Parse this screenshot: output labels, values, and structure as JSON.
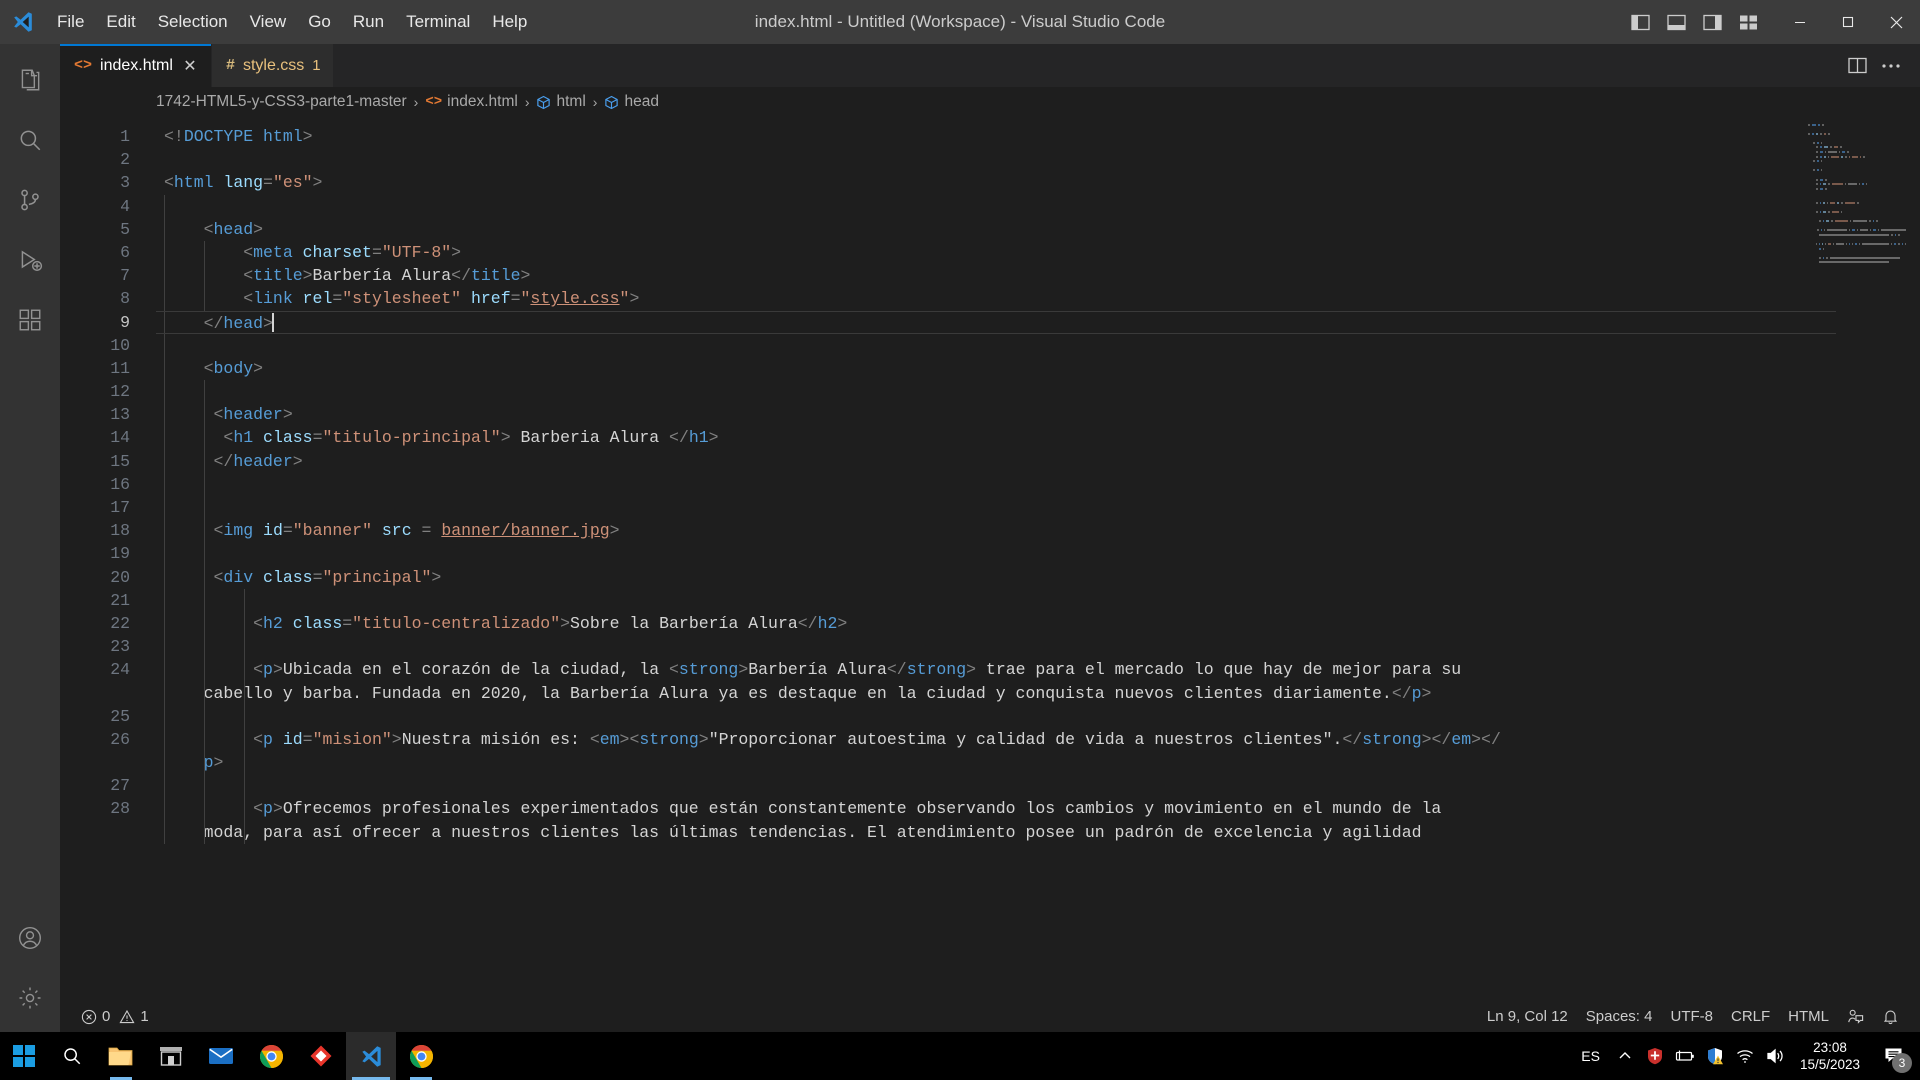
{
  "window": {
    "title": "index.html - Untitled (Workspace) - Visual Studio Code",
    "menu": [
      "File",
      "Edit",
      "Selection",
      "View",
      "Go",
      "Run",
      "Terminal",
      "Help"
    ],
    "controls": {
      "minimize": "−",
      "maximize": "☐",
      "close": "✕"
    },
    "layout_icons": [
      "panel-left-icon",
      "panel-bottom-icon",
      "panel-right-icon",
      "customize-layout-icon"
    ]
  },
  "activitybar": {
    "items": [
      {
        "name": "explorer",
        "icon": "files-icon"
      },
      {
        "name": "search",
        "icon": "search-icon"
      },
      {
        "name": "source-control",
        "icon": "source-control-icon"
      },
      {
        "name": "run-and-debug",
        "icon": "debug-icon"
      },
      {
        "name": "extensions",
        "icon": "extensions-icon"
      }
    ],
    "bottom": [
      {
        "name": "accounts",
        "icon": "account-icon"
      },
      {
        "name": "settings",
        "icon": "gear-icon"
      }
    ]
  },
  "tabs": [
    {
      "label": "index.html",
      "icon": "html5-icon",
      "active": true,
      "close": "✕",
      "badge": ""
    },
    {
      "label": "style.css",
      "icon": "css-icon",
      "active": false,
      "close": "",
      "badge": "1"
    }
  ],
  "tabs_actions": [
    "split-editor-icon",
    "more-actions-icon"
  ],
  "breadcrumb": [
    {
      "label": "1742-HTML5-y-CSS3-parte1-master",
      "icon": ""
    },
    {
      "label": "index.html",
      "icon": "html5-icon"
    },
    {
      "label": "html",
      "icon": "symbol-field-icon"
    },
    {
      "label": "head",
      "icon": "symbol-field-icon"
    }
  ],
  "breadcrumb_separator": "›",
  "editor": {
    "first_line": 1,
    "active_line": 9,
    "cursor_line_index": 8,
    "lines": [
      {
        "n": 1,
        "indent": 0,
        "tokens": [
          {
            "c": "punct",
            "t": "<!"
          },
          {
            "c": "doctype",
            "t": "DOCTYPE"
          },
          {
            "c": "txt",
            "t": " "
          },
          {
            "c": "tag",
            "t": "html"
          },
          {
            "c": "punct",
            "t": ">"
          }
        ]
      },
      {
        "n": 2,
        "indent": 0,
        "tokens": []
      },
      {
        "n": 3,
        "indent": 0,
        "tokens": [
          {
            "c": "punct",
            "t": "<"
          },
          {
            "c": "tag",
            "t": "html"
          },
          {
            "c": "txt",
            "t": " "
          },
          {
            "c": "attr",
            "t": "lang"
          },
          {
            "c": "punct",
            "t": "="
          },
          {
            "c": "str",
            "t": "\"es\""
          },
          {
            "c": "punct",
            "t": ">"
          }
        ]
      },
      {
        "n": 4,
        "indent": 1,
        "tokens": []
      },
      {
        "n": 5,
        "indent": 1,
        "tokens": [
          {
            "c": "txt",
            "t": "    "
          },
          {
            "c": "punct",
            "t": "<"
          },
          {
            "c": "tag",
            "t": "head"
          },
          {
            "c": "punct",
            "t": ">"
          }
        ]
      },
      {
        "n": 6,
        "indent": 2,
        "tokens": [
          {
            "c": "txt",
            "t": "        "
          },
          {
            "c": "punct",
            "t": "<"
          },
          {
            "c": "tag",
            "t": "meta"
          },
          {
            "c": "txt",
            "t": " "
          },
          {
            "c": "attr",
            "t": "charset"
          },
          {
            "c": "punct",
            "t": "="
          },
          {
            "c": "str",
            "t": "\"UTF-8\""
          },
          {
            "c": "punct",
            "t": ">"
          }
        ]
      },
      {
        "n": 7,
        "indent": 2,
        "tokens": [
          {
            "c": "txt",
            "t": "        "
          },
          {
            "c": "punct",
            "t": "<"
          },
          {
            "c": "tag",
            "t": "title"
          },
          {
            "c": "punct",
            "t": ">"
          },
          {
            "c": "txt",
            "t": "Barbería Alura"
          },
          {
            "c": "punct",
            "t": "</"
          },
          {
            "c": "tag",
            "t": "title"
          },
          {
            "c": "punct",
            "t": ">"
          }
        ]
      },
      {
        "n": 8,
        "indent": 2,
        "tokens": [
          {
            "c": "txt",
            "t": "        "
          },
          {
            "c": "punct",
            "t": "<"
          },
          {
            "c": "tag",
            "t": "link"
          },
          {
            "c": "txt",
            "t": " "
          },
          {
            "c": "attr",
            "t": "rel"
          },
          {
            "c": "punct",
            "t": "="
          },
          {
            "c": "str",
            "t": "\"stylesheet\""
          },
          {
            "c": "txt",
            "t": " "
          },
          {
            "c": "attr",
            "t": "href"
          },
          {
            "c": "punct",
            "t": "="
          },
          {
            "c": "str",
            "t": "\""
          },
          {
            "c": "link",
            "t": "style.css"
          },
          {
            "c": "str",
            "t": "\""
          },
          {
            "c": "punct",
            "t": ">"
          }
        ]
      },
      {
        "n": 9,
        "indent": 1,
        "active": true,
        "cursor": true,
        "tokens": [
          {
            "c": "txt",
            "t": "    "
          },
          {
            "c": "punct",
            "t": "</"
          },
          {
            "c": "tag",
            "t": "head"
          },
          {
            "c": "punct",
            "t": ">"
          }
        ]
      },
      {
        "n": 10,
        "indent": 1,
        "tokens": []
      },
      {
        "n": 11,
        "indent": 1,
        "tokens": [
          {
            "c": "txt",
            "t": "    "
          },
          {
            "c": "punct",
            "t": "<"
          },
          {
            "c": "tag",
            "t": "body"
          },
          {
            "c": "punct",
            "t": ">"
          }
        ]
      },
      {
        "n": 12,
        "indent": 2,
        "tokens": []
      },
      {
        "n": 13,
        "indent": 2,
        "tokens": [
          {
            "c": "txt",
            "t": "     "
          },
          {
            "c": "punct",
            "t": "<"
          },
          {
            "c": "tag",
            "t": "header"
          },
          {
            "c": "punct",
            "t": ">"
          }
        ]
      },
      {
        "n": 14,
        "indent": 2,
        "tokens": [
          {
            "c": "txt",
            "t": "      "
          },
          {
            "c": "punct",
            "t": "<"
          },
          {
            "c": "tag",
            "t": "h1"
          },
          {
            "c": "txt",
            "t": " "
          },
          {
            "c": "attr",
            "t": "class"
          },
          {
            "c": "punct",
            "t": "="
          },
          {
            "c": "str",
            "t": "\"titulo-principal\""
          },
          {
            "c": "punct",
            "t": ">"
          },
          {
            "c": "txt",
            "t": " Barberia Alura "
          },
          {
            "c": "punct",
            "t": "</"
          },
          {
            "c": "tag",
            "t": "h1"
          },
          {
            "c": "punct",
            "t": ">"
          }
        ]
      },
      {
        "n": 15,
        "indent": 2,
        "tokens": [
          {
            "c": "txt",
            "t": "     "
          },
          {
            "c": "punct",
            "t": "</"
          },
          {
            "c": "tag",
            "t": "header"
          },
          {
            "c": "punct",
            "t": ">"
          }
        ]
      },
      {
        "n": 16,
        "indent": 2,
        "tokens": []
      },
      {
        "n": 17,
        "indent": 2,
        "tokens": []
      },
      {
        "n": 18,
        "indent": 2,
        "tokens": [
          {
            "c": "txt",
            "t": "     "
          },
          {
            "c": "punct",
            "t": "<"
          },
          {
            "c": "tag",
            "t": "img"
          },
          {
            "c": "txt",
            "t": " "
          },
          {
            "c": "attr",
            "t": "id"
          },
          {
            "c": "punct",
            "t": "="
          },
          {
            "c": "str",
            "t": "\"banner\""
          },
          {
            "c": "txt",
            "t": " "
          },
          {
            "c": "attr",
            "t": "src"
          },
          {
            "c": "txt",
            "t": " "
          },
          {
            "c": "punct",
            "t": "= "
          },
          {
            "c": "link",
            "t": "banner/banner.jpg"
          },
          {
            "c": "punct",
            "t": ">"
          }
        ]
      },
      {
        "n": 19,
        "indent": 2,
        "tokens": []
      },
      {
        "n": 20,
        "indent": 2,
        "tokens": [
          {
            "c": "txt",
            "t": "     "
          },
          {
            "c": "punct",
            "t": "<"
          },
          {
            "c": "tag",
            "t": "div"
          },
          {
            "c": "txt",
            "t": " "
          },
          {
            "c": "attr",
            "t": "class"
          },
          {
            "c": "punct",
            "t": "="
          },
          {
            "c": "str",
            "t": "\"principal\""
          },
          {
            "c": "punct",
            "t": ">"
          }
        ]
      },
      {
        "n": 21,
        "indent": 3,
        "tokens": []
      },
      {
        "n": 22,
        "indent": 3,
        "tokens": [
          {
            "c": "txt",
            "t": "         "
          },
          {
            "c": "punct",
            "t": "<"
          },
          {
            "c": "tag",
            "t": "h2"
          },
          {
            "c": "txt",
            "t": " "
          },
          {
            "c": "attr",
            "t": "class"
          },
          {
            "c": "punct",
            "t": "="
          },
          {
            "c": "str",
            "t": "\"titulo-centralizado\""
          },
          {
            "c": "punct",
            "t": ">"
          },
          {
            "c": "txt",
            "t": "Sobre la Barbería Alura"
          },
          {
            "c": "punct",
            "t": "</"
          },
          {
            "c": "tag",
            "t": "h2"
          },
          {
            "c": "punct",
            "t": ">"
          }
        ]
      },
      {
        "n": 23,
        "indent": 3,
        "tokens": []
      },
      {
        "n": 24,
        "indent": 3,
        "tokens": [
          {
            "c": "txt",
            "t": "         "
          },
          {
            "c": "punct",
            "t": "<"
          },
          {
            "c": "tag",
            "t": "p"
          },
          {
            "c": "punct",
            "t": ">"
          },
          {
            "c": "txt",
            "t": "Ubicada en el corazón de la ciudad, la "
          },
          {
            "c": "punct",
            "t": "<"
          },
          {
            "c": "tag",
            "t": "strong"
          },
          {
            "c": "punct",
            "t": ">"
          },
          {
            "c": "txt",
            "t": "Barbería Alura"
          },
          {
            "c": "punct",
            "t": "</"
          },
          {
            "c": "tag",
            "t": "strong"
          },
          {
            "c": "punct",
            "t": ">"
          },
          {
            "c": "txt",
            "t": " trae para el mercado lo que hay de mejor para su"
          }
        ]
      },
      {
        "n": "",
        "indent": 3,
        "wrap": true,
        "tokens": [
          {
            "c": "txt",
            "t": "    cabello y barba. Fundada en 2020, la Barbería Alura ya es destaque en la ciudad y conquista nuevos clientes diariamente."
          },
          {
            "c": "punct",
            "t": "</"
          },
          {
            "c": "tag",
            "t": "p"
          },
          {
            "c": "punct",
            "t": ">"
          }
        ]
      },
      {
        "n": 25,
        "indent": 3,
        "tokens": []
      },
      {
        "n": 26,
        "indent": 3,
        "tokens": [
          {
            "c": "txt",
            "t": "         "
          },
          {
            "c": "punct",
            "t": "<"
          },
          {
            "c": "tag",
            "t": "p"
          },
          {
            "c": "txt",
            "t": " "
          },
          {
            "c": "attr",
            "t": "id"
          },
          {
            "c": "punct",
            "t": "="
          },
          {
            "c": "str",
            "t": "\"mision\""
          },
          {
            "c": "punct",
            "t": ">"
          },
          {
            "c": "txt",
            "t": "Nuestra misión es: "
          },
          {
            "c": "punct",
            "t": "<"
          },
          {
            "c": "tag",
            "t": "em"
          },
          {
            "c": "punct",
            "t": "><"
          },
          {
            "c": "tag",
            "t": "strong"
          },
          {
            "c": "punct",
            "t": ">"
          },
          {
            "c": "txt",
            "t": "\"Proporcionar autoestima y calidad de vida a nuestros clientes\"."
          },
          {
            "c": "punct",
            "t": "</"
          },
          {
            "c": "tag",
            "t": "strong"
          },
          {
            "c": "punct",
            "t": "></"
          },
          {
            "c": "tag",
            "t": "em"
          },
          {
            "c": "punct",
            "t": "></"
          }
        ]
      },
      {
        "n": "",
        "indent": 3,
        "wrap": true,
        "tokens": [
          {
            "c": "txt",
            "t": "    "
          },
          {
            "c": "tag",
            "t": "p"
          },
          {
            "c": "punct",
            "t": ">"
          }
        ]
      },
      {
        "n": 27,
        "indent": 3,
        "tokens": []
      },
      {
        "n": 28,
        "indent": 3,
        "tokens": [
          {
            "c": "txt",
            "t": "         "
          },
          {
            "c": "punct",
            "t": "<"
          },
          {
            "c": "tag",
            "t": "p"
          },
          {
            "c": "punct",
            "t": ">"
          },
          {
            "c": "txt",
            "t": "Ofrecemos profesionales experimentados que están constantemente observando los cambios y movimiento en el mundo de la"
          }
        ]
      },
      {
        "n": "",
        "indent": 3,
        "wrap": true,
        "clipped": true,
        "tokens": [
          {
            "c": "txt",
            "t": "    moda, para así ofrecer a nuestros clientes las últimas tendencias. El atendimiento posee un padrón de excelencia y agilidad"
          }
        ]
      }
    ]
  },
  "statusbar": {
    "left": [
      {
        "name": "problems",
        "icon": "error-icon",
        "text": "0",
        "icon2": "warning-icon",
        "text2": "1"
      }
    ],
    "errors": "0",
    "warnings": "1",
    "right": [
      {
        "name": "editor-position",
        "label": "Ln 9, Col 12"
      },
      {
        "name": "editor-indentation",
        "label": "Spaces: 4"
      },
      {
        "name": "editor-encoding",
        "label": "UTF-8"
      },
      {
        "name": "editor-eol",
        "label": "CRLF"
      },
      {
        "name": "editor-language",
        "label": "HTML"
      }
    ],
    "right_icons": [
      "feedback-icon",
      "bell-icon"
    ]
  },
  "taskbar": {
    "start": "windows-start-icon",
    "search": "search-icon",
    "apps": [
      {
        "name": "file-explorer",
        "icon": "folder-icon",
        "state": "running"
      },
      {
        "name": "microsoft-store",
        "icon": "store-icon",
        "state": ""
      },
      {
        "name": "mail",
        "icon": "mail-icon",
        "state": ""
      },
      {
        "name": "google-chrome",
        "icon": "chrome-icon",
        "state": ""
      },
      {
        "name": "adobe-app",
        "icon": "diamond-icon",
        "state": ""
      },
      {
        "name": "visual-studio-code",
        "icon": "vscode-icon",
        "state": "active"
      },
      {
        "name": "google-chrome-2",
        "icon": "chrome-icon",
        "state": "running"
      }
    ],
    "language": "ES",
    "tray": [
      "show-hidden-icons",
      "security-shield-icon",
      "battery-icon",
      "windows-defender-warning-icon",
      "wifi-icon",
      "volume-icon"
    ],
    "time": "23:08",
    "date": "15/5/2023",
    "notification_count": "3"
  },
  "colors": {
    "accent": "#0078d4",
    "tab_modified": "#e8c07d",
    "editor_bg": "#1e1e1e",
    "sidebar_bg": "#333333",
    "titlebar_bg": "#3c3c3c"
  }
}
